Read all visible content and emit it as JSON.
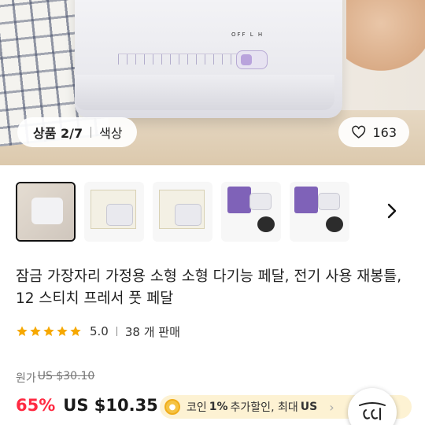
{
  "hero": {
    "switch_label": "OFF L H",
    "position_label": "상품 2/7",
    "option_label": "색상",
    "like_count": "163"
  },
  "thumbnails": [
    {
      "kind": "product-photo",
      "selected": true
    },
    {
      "kind": "box-front",
      "selected": false
    },
    {
      "kind": "box-front",
      "selected": false
    },
    {
      "kind": "purple-bag-accessories",
      "selected": false
    },
    {
      "kind": "purple-bag-accessories",
      "selected": false
    }
  ],
  "product": {
    "title": "잠금 가장자리 가정용 소형 소형 다기능 페달, 전기 사용 재봉틀, 12 스티치 프레서 풋 페달",
    "rating": "5.0",
    "sold": "38 개 판매",
    "original_price_label": "원가",
    "original_price": "US $30.10",
    "discount": "65%",
    "price": "US $10.35",
    "coin_text_1": "코인",
    "coin_bold": "1%",
    "coin_text_2": "추가할인, 최대",
    "coin_bold_2": "US",
    "coin_tail": "›"
  },
  "icons": {
    "heart": "heart-icon",
    "star": "star-icon",
    "chevron": "chevron-right-icon",
    "coin": "coin-icon",
    "fab": "deal-badge-icon"
  },
  "colors": {
    "discount": "#ff2a42",
    "star": "#f6a800",
    "coin_bg": "#fdf2d3"
  }
}
